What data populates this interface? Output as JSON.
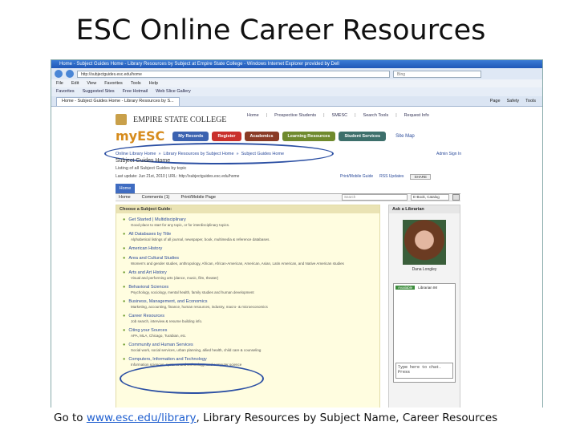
{
  "slide": {
    "title": "ESC Online Career Resources",
    "caption_prefix": "Go to ",
    "caption_link": "www.esc.edu/library",
    "caption_suffix": ", Library Resources by Subject Name, Career Resources"
  },
  "browser": {
    "title": "Home - Subject Guides Home - Library Resources by Subject at Empire State College - Windows Internet Explorer provided by Dell",
    "address": "http://subjectguides.esc.edu/home",
    "search_placeholder": "Bing",
    "menu": [
      "File",
      "Edit",
      "View",
      "Favorites",
      "Tools",
      "Help"
    ],
    "favorites": [
      "Favorites",
      "Suggested Sites",
      "Free Hotmail",
      "Web Slice Gallery"
    ],
    "tab": "Home - Subject Guides Home - Library Resources by S...",
    "tools": [
      "Page",
      "Safety",
      "Tools"
    ]
  },
  "site": {
    "logo": "EMPIRE STATE COLLEGE",
    "toplinks": [
      "Home",
      "Prospective Students",
      "SMESC",
      "Search Tools",
      "Request Info"
    ],
    "brand": "myESC",
    "nav": [
      "My Records",
      "Register",
      "Academics",
      "Learning Resources",
      "Student Services"
    ],
    "sitemap": "Site Map",
    "breadcrumbs": [
      "Online Library Home",
      "Library Resources by Subject Home",
      "Subject Guides Home"
    ],
    "signin": "Admin Sign In",
    "page_title": "Subject Guides Home",
    "page_sub": "Listing of all Subject Guides by topic",
    "page_meta": "Last update: Jun 21st, 2010 | URL: http://subjectguides.esc.edu/home",
    "actions": [
      "Print/Mobile Guide",
      "RSS Updates",
      "SHARE"
    ],
    "home_tab": "Home",
    "subbar": [
      "Home",
      "Comments (1)",
      "Print/Mobile Page"
    ],
    "search_placeholder": "Search",
    "search_scope": "E-Book, Catalog",
    "guides_header": "Choose a Subject Guide:",
    "guides": [
      {
        "name": "Get Started | Multidisciplinary",
        "desc": "Good place to start for any topic, or for interdisciplinary topics."
      },
      {
        "name": "All Databases by Title",
        "desc": "Alphabetical listings of all journal, newspaper, book, multimedia & reference databases."
      },
      {
        "name": "American History",
        "desc": ""
      },
      {
        "name": "Area and Cultural Studies",
        "desc": "Women's and gender studies, anthropology, African, African-American, American, Asian, Latin American, and Native American studies"
      },
      {
        "name": "Arts and Art History",
        "desc": "Visual and performing arts (dance, music, film, theater)"
      },
      {
        "name": "Behavioral Sciences",
        "desc": "Psychology, sociology, mental health, family studies and human development"
      },
      {
        "name": "Business, Management, and Economics",
        "desc": "Marketing, accounting, finance, human resources, industry, macro- & microeconomics"
      },
      {
        "name": "Career Resources",
        "desc": "Job search, interview & resume building info."
      },
      {
        "name": "Citing your Sources",
        "desc": "APA, MLA, Chicago, Turabian, etc."
      },
      {
        "name": "Community and Human Services",
        "desc": "Social work, social services, urban planning, allied health, child care & counseling"
      },
      {
        "name": "Computers, Information and Technology",
        "desc": "Information sciences, systems and technology, and computer science"
      }
    ],
    "ask_header": "Ask a Librarian",
    "librarian": "Dana Longley",
    "chat_status": "Available",
    "chat_title": "Librarian IM",
    "chat_placeholder": "Type here to chat. Press"
  }
}
